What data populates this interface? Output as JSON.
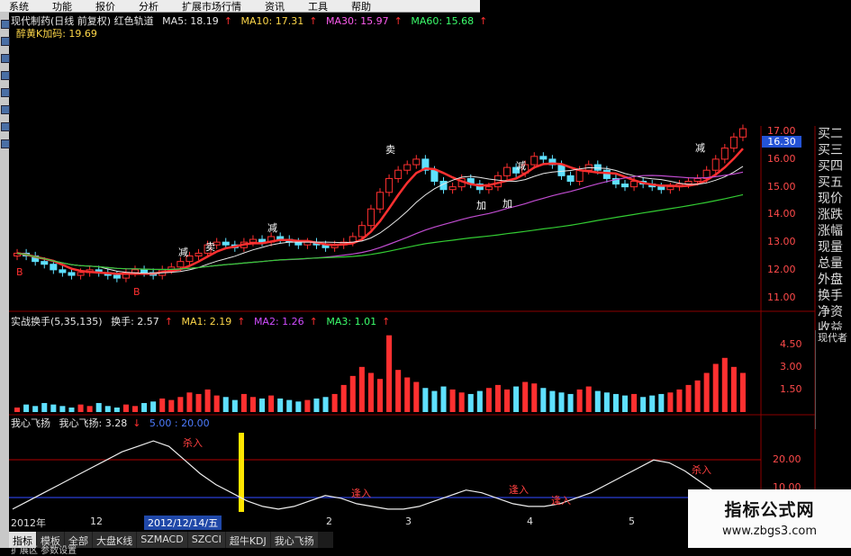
{
  "menu": [
    "系统",
    "功能",
    "报价",
    "分析",
    "扩展市场行情",
    "资讯",
    "工具",
    "帮助"
  ],
  "price_header": {
    "title": "现代制药(日线 前复权) 红色轨道",
    "ma5": "MA5: 18.19",
    "ma10": "MA10: 17.31",
    "ma30": "MA30: 15.97",
    "ma60": "MA60: 15.68",
    "line2": "醉黄K加码: 19.69"
  },
  "vol_header": {
    "title": "实战换手(5,35,135)",
    "turnover": "换手: 2.57",
    "ma1": "MA1: 2.19",
    "ma2": "MA2: 1.26",
    "ma3": "MA3: 1.01"
  },
  "ind_header": {
    "title": "我心飞扬",
    "value": "我心飞扬: 3.28",
    "levels": "5.00 : 20.00"
  },
  "price_axis": [
    "17.00",
    "16.00",
    "15.00",
    "14.00",
    "13.00",
    "12.00",
    "11.00"
  ],
  "current_price": "16.30",
  "vol_axis": [
    "4.50",
    "3.00",
    "1.50"
  ],
  "ind_axis": [
    "20.00",
    "10.00"
  ],
  "right_panel": [
    "买二",
    "买三",
    "买四",
    "买五",
    "现价",
    "涨跌",
    "涨幅",
    "现量",
    "总量",
    "外盘",
    "换手",
    "净资",
    "收益"
  ],
  "mini_label": "现代者",
  "dates": {
    "year": "2012年",
    "m12": "12",
    "selected": "2012/12/14/五",
    "m2": "2",
    "m3": "3",
    "m4": "4",
    "m5": "5"
  },
  "tabs": [
    "指标",
    "模板",
    "全部",
    "大盘K线",
    "SZMACD",
    "SZCCI",
    "超牛KDJ",
    "我心飞扬"
  ],
  "bottom_label": "扩展区 参数设置",
  "annotations": {
    "sell": "卖",
    "reduce": "减",
    "add": "加",
    "buy_small": "B",
    "sell_in": "杀入",
    "step_in": "逢入"
  },
  "watermark": {
    "title": "指标公式网",
    "url": "www.zbgs3.com"
  },
  "colors": {
    "up": "#ff3030",
    "down": "#5fe0ff",
    "ma_white": "#e8e8e8",
    "ma_pink": "#c04cd0",
    "ma_green": "#33cc33",
    "highlight": "#ffe600"
  },
  "chart_data": [
    {
      "type": "candlestick",
      "ylim": [
        10.5,
        17.2
      ],
      "close": [
        12.6,
        12.5,
        12.3,
        12.2,
        12.0,
        11.9,
        11.8,
        11.9,
        12.0,
        11.9,
        11.8,
        11.7,
        11.9,
        12.0,
        11.9,
        11.8,
        12.0,
        12.1,
        12.3,
        12.5,
        12.6,
        12.9,
        13.0,
        12.9,
        12.8,
        13.0,
        13.1,
        13.0,
        13.2,
        13.1,
        13.0,
        12.9,
        13.0,
        12.9,
        12.8,
        12.9,
        13.0,
        13.2,
        13.6,
        14.2,
        14.8,
        15.3,
        15.6,
        15.8,
        16.0,
        15.6,
        15.2,
        14.9,
        15.0,
        15.3,
        15.1,
        14.9,
        15.0,
        15.4,
        15.7,
        15.5,
        15.8,
        16.1,
        16.0,
        15.8,
        15.4,
        15.2,
        15.6,
        15.8,
        15.6,
        15.3,
        15.1,
        15.0,
        15.2,
        15.1,
        15.0,
        14.9,
        15.0,
        15.1,
        15.2,
        15.3,
        15.6,
        16.0,
        16.4,
        16.8,
        17.1
      ]
    },
    {
      "type": "bar",
      "series": [
        {
          "name": "换手",
          "values": [
            0.3,
            0.5,
            0.4,
            0.6,
            0.5,
            0.4,
            0.3,
            0.5,
            0.4,
            0.6,
            0.4,
            0.3,
            0.5,
            0.4,
            0.6,
            0.7,
            0.9,
            0.8,
            1.0,
            1.3,
            1.2,
            1.5,
            1.1,
            1.0,
            0.8,
            1.2,
            1.0,
            0.9,
            1.1,
            0.9,
            0.8,
            0.7,
            0.8,
            0.9,
            1.0,
            1.2,
            1.8,
            2.4,
            3.0,
            2.6,
            2.2,
            5.1,
            2.8,
            2.3,
            2.0,
            1.6,
            1.4,
            1.7,
            1.5,
            1.3,
            1.2,
            1.4,
            1.6,
            1.8,
            1.5,
            1.7,
            2.0,
            1.9,
            1.6,
            1.4,
            1.3,
            1.2,
            1.5,
            1.7,
            1.4,
            1.3,
            1.2,
            1.1,
            1.2,
            1.0,
            1.1,
            1.2,
            1.3,
            1.5,
            1.8,
            2.1,
            2.6,
            3.2,
            3.6,
            3.0,
            2.6
          ]
        }
      ],
      "ylim": [
        0,
        5.5
      ]
    },
    {
      "type": "line",
      "series": [
        {
          "name": "我心飞扬",
          "values": [
            2,
            5,
            8,
            11,
            14,
            17,
            20,
            23,
            25,
            27,
            25,
            20,
            15,
            11,
            8,
            5,
            3,
            2,
            3,
            5,
            7,
            6,
            4,
            3,
            2,
            2,
            3,
            5,
            7,
            9,
            8,
            6,
            4,
            3,
            3,
            4,
            6,
            8,
            11,
            14,
            17,
            20,
            19,
            16,
            12,
            8,
            5,
            3
          ]
        }
      ],
      "ylim": [
        0,
        30
      ]
    }
  ]
}
